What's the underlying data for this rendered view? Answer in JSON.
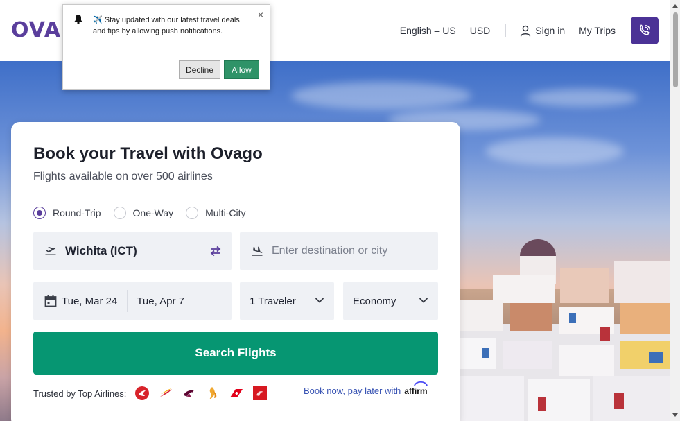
{
  "header": {
    "logo": "OVAGO",
    "language": "English – US",
    "currency": "USD",
    "sign_in": "Sign in",
    "my_trips": "My Trips"
  },
  "popup": {
    "message": "✈️ Stay updated with our latest travel deals and tips by allowing push notifications.",
    "close": "×",
    "decline": "Decline",
    "allow": "Allow"
  },
  "booking": {
    "title": "Book your Travel with Ovago",
    "subtitle": "Flights available on over 500 airlines",
    "trip_types": [
      {
        "label": "Round-Trip",
        "selected": true
      },
      {
        "label": "One-Way",
        "selected": false
      },
      {
        "label": "Multi-City",
        "selected": false
      }
    ],
    "from_value": "Wichita (ICT)",
    "to_placeholder": "Enter destination or city",
    "depart_date": "Tue, Mar 24",
    "return_date": "Tue, Apr 7",
    "travelers": "1 Traveler",
    "cabin_class": "Economy",
    "search_button": "Search Flights",
    "trusted_label": "Trusted by Top Airlines:",
    "affirm_text": "Book now, pay later with",
    "affirm_logo": "affirm"
  },
  "colors": {
    "brand_purple": "#5a3e9c",
    "call_button": "#4b3296",
    "search_green": "#069672",
    "allow_green": "#2f9368",
    "link_blue": "#3a55b4"
  },
  "icons": [
    "bell-icon",
    "user-icon",
    "phone-icon",
    "takeoff-icon",
    "swap-icon",
    "landing-icon",
    "calendar-icon",
    "chevron-down-icon"
  ]
}
